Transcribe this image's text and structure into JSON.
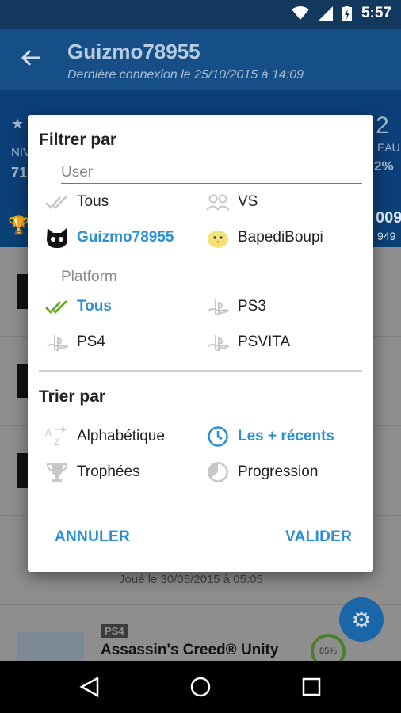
{
  "statusbar": {
    "time": "5:57",
    "icons": [
      "wifi-icon",
      "signal-icon",
      "battery-charging-icon"
    ]
  },
  "appbar": {
    "title": "Guizmo78955",
    "subtitle": "Dernière connexion le  25/10/2015 à 14:09"
  },
  "background": {
    "profile_fragments": {
      "level_left": "NIV",
      "value_left": "71",
      "level_right": "EAU",
      "value_right": "2%",
      "num_right": "2"
    },
    "trophy_fragments": {
      "count_top": "009",
      "count_bottom": "949"
    },
    "played_line": "Joué le 30/05/2015 à 05:05",
    "game_platform": "PS4",
    "game_title": "Assassin's Creed® Unity",
    "game_progress": "85%"
  },
  "dialog": {
    "filter_title": "Filtrer par",
    "user_section": "User",
    "user_options": [
      {
        "label": "Tous",
        "icon": "double-check-icon",
        "selected": false
      },
      {
        "label": "VS",
        "icon": "users-icon",
        "selected": false
      },
      {
        "label": "Guizmo78955",
        "icon": "cat-avatar-icon",
        "selected": true
      },
      {
        "label": "BapediBoupi",
        "icon": "chick-avatar-icon",
        "selected": false
      }
    ],
    "platform_section": "Platform",
    "platform_options": [
      {
        "label": "Tous",
        "icon": "double-check-icon",
        "selected": true
      },
      {
        "label": "PS3",
        "icon": "playstation-icon",
        "selected": false
      },
      {
        "label": "PS4",
        "icon": "playstation-icon",
        "selected": false
      },
      {
        "label": "PSVITA",
        "icon": "playstation-icon",
        "selected": false
      }
    ],
    "sort_title": "Trier par",
    "sort_options": [
      {
        "label": "Alphabétique",
        "icon": "alphabetical-icon",
        "selected": false
      },
      {
        "label": "Les + récents",
        "icon": "clock-icon",
        "selected": true
      },
      {
        "label": "Trophées",
        "icon": "trophy-icon",
        "selected": false
      },
      {
        "label": "Progression",
        "icon": "progress-icon",
        "selected": false
      }
    ],
    "cancel_label": "ANNULER",
    "ok_label": "VALIDER"
  },
  "colors": {
    "accent": "#2c8fd6",
    "selected_check": "#6aa829",
    "appbar": "#164f87"
  }
}
